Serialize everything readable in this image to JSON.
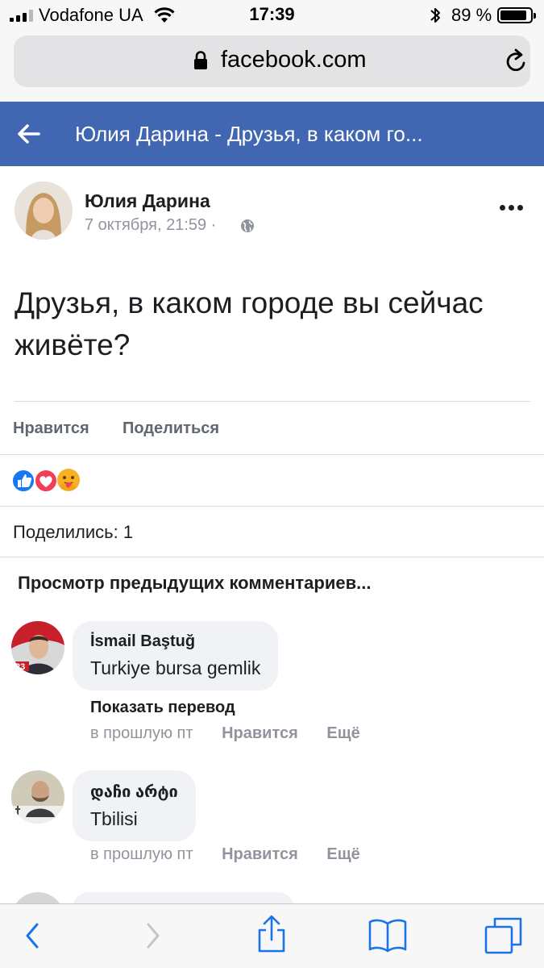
{
  "status_bar": {
    "carrier": "Vodafone UA",
    "time": "17:39",
    "battery_pct": "89 %",
    "battery_level": 0.89
  },
  "browser": {
    "url": "facebook.com"
  },
  "header": {
    "title": "Юлия Дарина - Друзья, в каком го..."
  },
  "post": {
    "author": "Юлия Дарина",
    "timestamp": "7 октября, 21:59 ·",
    "text": "Друзья, в каком городе вы сейчас живёте?",
    "like_label": "Нравится",
    "share_label": "Поделиться",
    "shares": "Поделились: 1",
    "reactions": [
      "like",
      "love",
      "care"
    ]
  },
  "comments": {
    "view_previous": "Просмотр предыдущих комментариев...",
    "items": [
      {
        "author": "İsmail Baştuğ",
        "text": "Turkiye bursa gemlik",
        "translate": "Показать перевод",
        "time": "в прошлую пт",
        "like": "Нравится",
        "more": "Ещё"
      },
      {
        "author": "დაჩი არტი",
        "text": "Tbilisi",
        "time": "в прошлую пт",
        "like": "Нравится",
        "more": "Ещё"
      }
    ]
  },
  "colors": {
    "facebook_blue": "#4267b2",
    "like_blue": "#1877f2",
    "love_red": "#f33e58",
    "care_yellow": "#f7b125"
  }
}
